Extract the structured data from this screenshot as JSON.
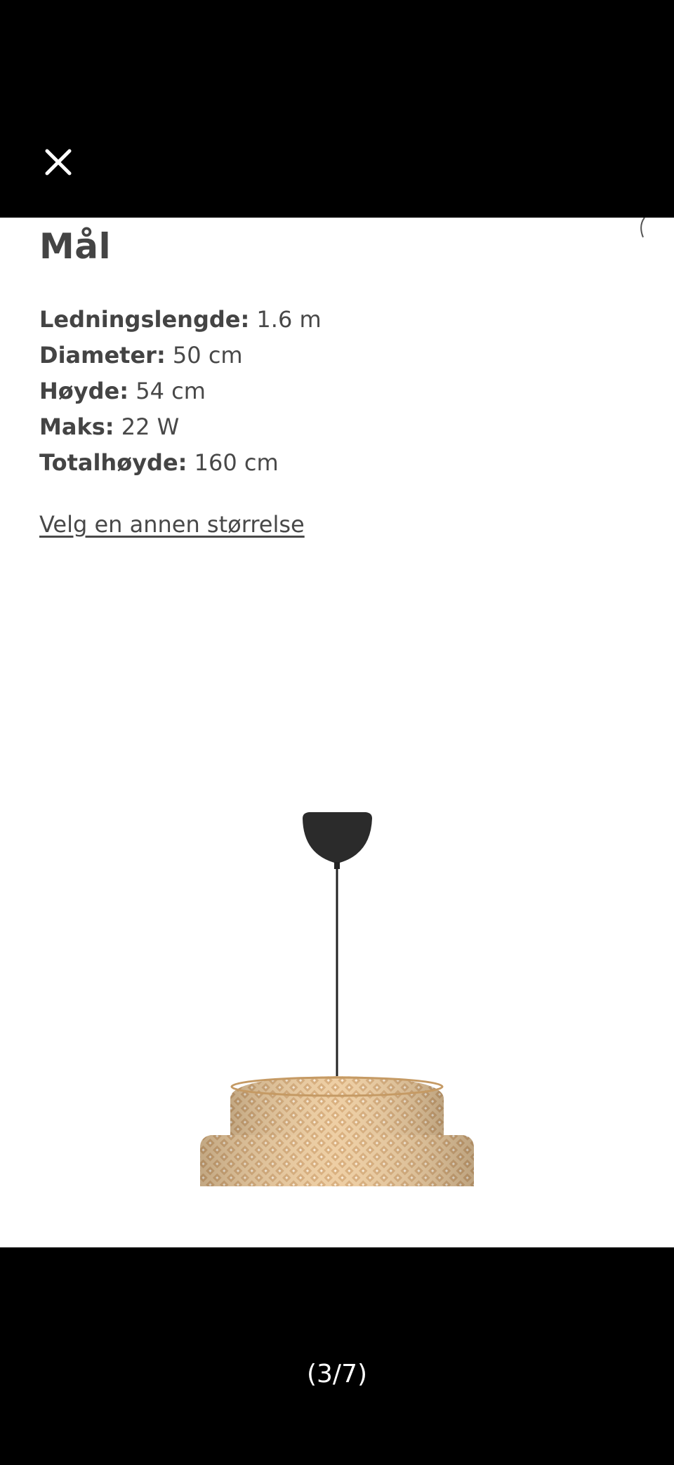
{
  "viewer": {
    "close_icon": "close-icon",
    "counter": "(3/7)"
  },
  "product_image": {
    "heading": "Mål",
    "specs": [
      {
        "label": "Ledningslengde:",
        "value": " 1.6 m"
      },
      {
        "label": "Diameter:",
        "value": " 50 cm"
      },
      {
        "label": "Høyde:",
        "value": " 54 cm"
      },
      {
        "label": "Maks:",
        "value": " 22 W"
      },
      {
        "label": "Totalhøyde:",
        "value": " 160 cm"
      }
    ],
    "size_link": "Velg en annen størrelse",
    "lamp_colors": {
      "canopy": "#2a2a2a",
      "shade": "#e8c193",
      "weave": "#b8864f"
    }
  }
}
